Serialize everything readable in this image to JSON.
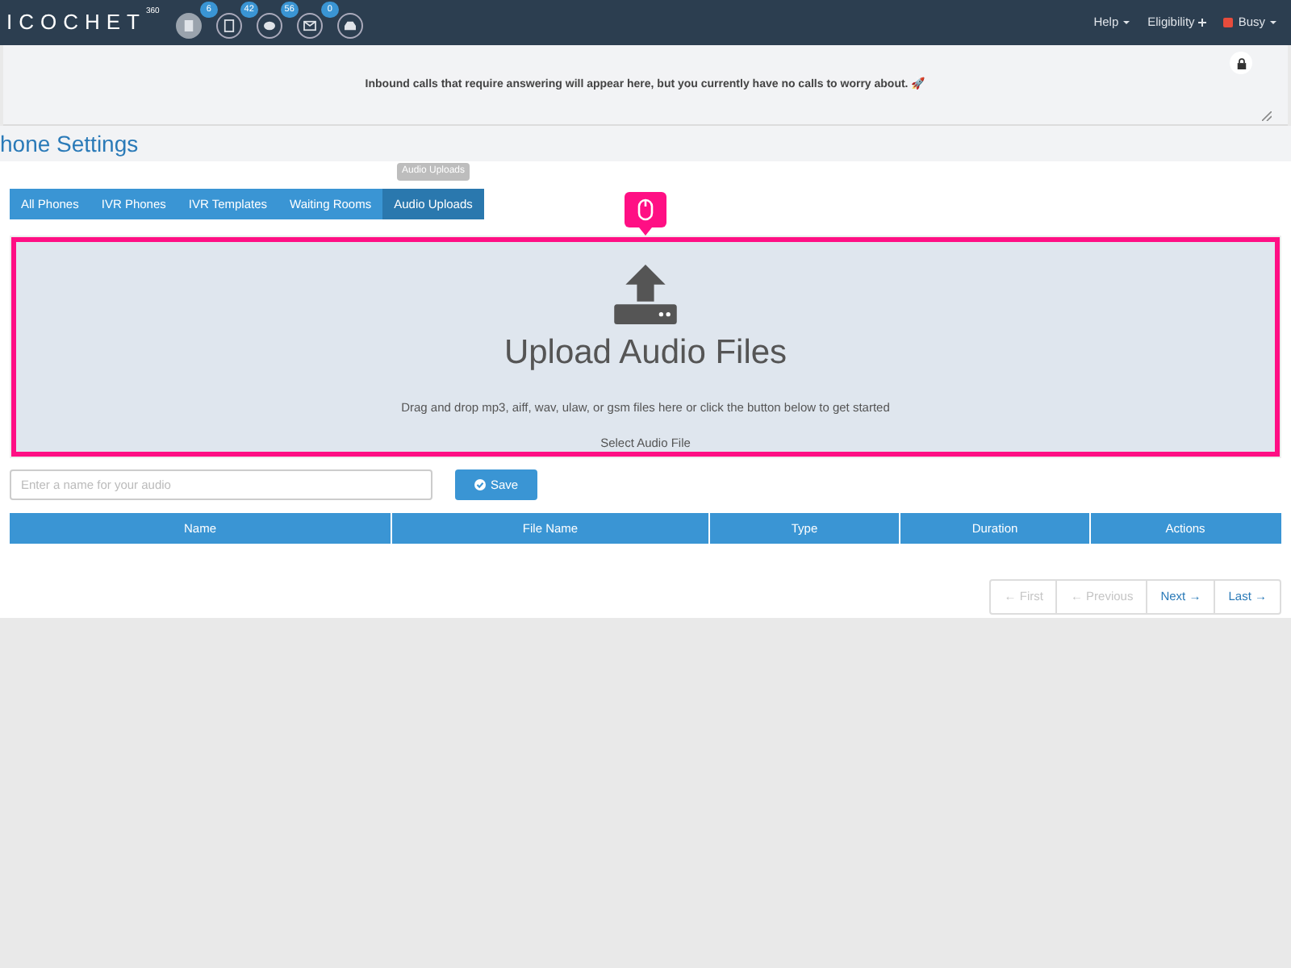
{
  "navbar": {
    "logo": "ICOCHET",
    "logo_sup": "360",
    "icons": [
      {
        "kind": "file",
        "badge": "6",
        "active": true
      },
      {
        "kind": "doc",
        "badge": "42",
        "active": false
      },
      {
        "kind": "chat",
        "badge": "56",
        "active": false
      },
      {
        "kind": "mail",
        "badge": "0",
        "active": false
      },
      {
        "kind": "inbox",
        "active": false
      }
    ],
    "menus": [
      {
        "label": "Help",
        "kind": "caret"
      },
      {
        "label": "Eligibility",
        "kind": "plus"
      },
      {
        "label": "Busy",
        "kind": "status",
        "color": "#e74c3c"
      }
    ]
  },
  "notice": {
    "text": "Inbound calls that require answering will appear here, but you currently have no calls to worry about. 🚀"
  },
  "page_title": "hone Settings",
  "tooltip": "Audio Uploads",
  "tabs": [
    {
      "label": "All Phones",
      "selected": false
    },
    {
      "label": "IVR Phones",
      "selected": false
    },
    {
      "label": "IVR Templates",
      "selected": false
    },
    {
      "label": "Waiting Rooms",
      "selected": false
    },
    {
      "label": "Audio Uploads",
      "selected": true
    }
  ],
  "dropzone": {
    "title": "Upload Audio Files",
    "hint": "Drag and drop mp3, aiff, wav, ulaw, or gsm files here or click the button below to get started",
    "button": "Select Audio File"
  },
  "name_field": {
    "placeholder": "Enter a name for your audio"
  },
  "save_button": "Save",
  "table": {
    "columns": [
      "Name",
      "File Name",
      "Type",
      "Duration",
      "Actions"
    ]
  },
  "pagination": [
    {
      "label": "← First",
      "disabled": true
    },
    {
      "label": "← Previous",
      "disabled": true
    },
    {
      "label": "Next →",
      "disabled": false
    },
    {
      "label": "Last →",
      "disabled": false
    }
  ]
}
